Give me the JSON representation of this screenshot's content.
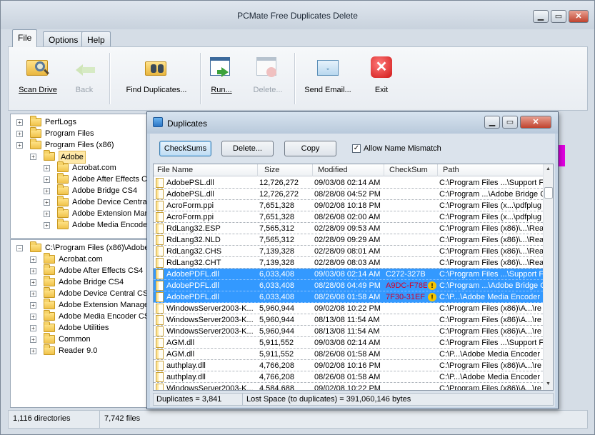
{
  "window": {
    "title": "PCMate Free Duplicates Delete",
    "minimize": "▁",
    "maximize": "▭",
    "close": "✕"
  },
  "tabs": [
    "File",
    "Options",
    "Help"
  ],
  "ribbon": {
    "scan_drive": "Scan Drive",
    "back": "Back",
    "find_duplicates": "Find Duplicates...",
    "run": "Run...",
    "delete": "Delete...",
    "send_email": "Send Email...",
    "exit": "Exit"
  },
  "tree_top": [
    {
      "label": "PerfLogs",
      "level": 0
    },
    {
      "label": "Program Files",
      "level": 0
    },
    {
      "label": "Program Files (x86)",
      "level": 0
    },
    {
      "label": "Adobe",
      "level": 1
    },
    {
      "label": "Acrobat.com",
      "level": 2
    },
    {
      "label": "Adobe After Effects CS4",
      "level": 2
    },
    {
      "label": "Adobe Bridge CS4",
      "level": 2
    },
    {
      "label": "Adobe Device Central CS4",
      "level": 2
    },
    {
      "label": "Adobe Extension Manager",
      "level": 2
    },
    {
      "label": "Adobe Media Encoder CS4",
      "level": 2
    }
  ],
  "tree_bottom": [
    {
      "label": "C:\\Program Files (x86)\\Adobe",
      "level": 0
    },
    {
      "label": "Acrobat.com",
      "level": 1
    },
    {
      "label": "Adobe After Effects CS4",
      "level": 1
    },
    {
      "label": "Adobe Bridge CS4",
      "level": 1
    },
    {
      "label": "Adobe Device Central CS4",
      "level": 1
    },
    {
      "label": "Adobe Extension Manager",
      "level": 1
    },
    {
      "label": "Adobe Media Encoder CS4",
      "level": 1
    },
    {
      "label": "Adobe Utilities",
      "level": 1
    },
    {
      "label": "Common",
      "level": 1
    },
    {
      "label": "Reader 9.0",
      "level": 1
    }
  ],
  "status": {
    "directories": "1,116 directories",
    "files": "7,742 files"
  },
  "dialog": {
    "title": "Duplicates",
    "checksums_btn": "CheckSums",
    "delete_btn": "Delete...",
    "copy_btn": "Copy",
    "allow_mismatch": "Allow Name Mismatch",
    "allow_mismatch_checked": "✓",
    "columns": [
      "File Name",
      "Size",
      "Modified",
      "CheckSum",
      "Path"
    ],
    "rows": [
      {
        "name": "AdobePSL.dll",
        "size": "12,726,272",
        "mod": "09/03/08 02:14 AM",
        "sum": "",
        "path": "C:\\Program Files ...\\Support F",
        "sel": false,
        "warn": false
      },
      {
        "name": "AdobePSL.dll",
        "size": "12,726,272",
        "mod": "08/28/08 04:52 PM",
        "sum": "",
        "path": "C:\\Program ...\\Adobe Bridge C",
        "sel": false,
        "warn": false
      },
      {
        "name": "AcroForm.ppi",
        "size": "7,651,328",
        "mod": "09/02/08 10:18 PM",
        "sum": "",
        "path": "C:\\Program Files (x...\\pdfplug",
        "sel": false,
        "warn": false
      },
      {
        "name": "AcroForm.ppi",
        "size": "7,651,328",
        "mod": "08/26/08 02:00 AM",
        "sum": "",
        "path": "C:\\Program Files (x...\\pdfplug",
        "sel": false,
        "warn": false
      },
      {
        "name": "RdLang32.ESP",
        "size": "7,565,312",
        "mod": "02/28/09 09:53 AM",
        "sum": "",
        "path": "C:\\Program Files (x86)\\...\\Rea",
        "sel": false,
        "warn": false
      },
      {
        "name": "RdLang32.NLD",
        "size": "7,565,312",
        "mod": "02/28/09 09:29 AM",
        "sum": "",
        "path": "C:\\Program Files (x86)\\...\\Rea",
        "sel": false,
        "warn": false
      },
      {
        "name": "RdLang32.CHS",
        "size": "7,139,328",
        "mod": "02/28/09 08:01 AM",
        "sum": "",
        "path": "C:\\Program Files (x86)\\...\\Rea",
        "sel": false,
        "warn": false
      },
      {
        "name": "RdLang32.CHT",
        "size": "7,139,328",
        "mod": "02/28/09 08:03 AM",
        "sum": "",
        "path": "C:\\Program Files (x86)\\...\\Rea",
        "sel": false,
        "warn": false
      },
      {
        "name": "AdobePDFL.dll",
        "size": "6,033,408",
        "mod": "09/03/08 02:14 AM",
        "sum": "C272-327B",
        "path": "C:\\Program Files ...\\Support F",
        "sel": true,
        "warn": false,
        "sumcolor": "#ffffff"
      },
      {
        "name": "AdobePDFL.dll",
        "size": "6,033,408",
        "mod": "08/28/08 04:49 PM",
        "sum": "A9DC-F78E",
        "path": "C:\\Program ...\\Adobe Bridge C",
        "sel": true,
        "warn": true,
        "sumcolor": "#d4002a"
      },
      {
        "name": "AdobePDFL.dll",
        "size": "6,033,408",
        "mod": "08/26/08 01:58 AM",
        "sum": "7F30-31EF",
        "path": "C:\\P...\\Adobe Media Encoder",
        "sel": true,
        "warn": true,
        "sumcolor": "#d4002a"
      },
      {
        "name": "WindowsServer2003-K...",
        "size": "5,960,944",
        "mod": "09/02/08 10:22 PM",
        "sum": "",
        "path": "C:\\Program Files (x86)\\A...\\re",
        "sel": false,
        "warn": false
      },
      {
        "name": "WindowsServer2003-K...",
        "size": "5,960,944",
        "mod": "08/13/08 11:54 AM",
        "sum": "",
        "path": "C:\\Program Files (x86)\\A...\\re",
        "sel": false,
        "warn": false
      },
      {
        "name": "WindowsServer2003-K...",
        "size": "5,960,944",
        "mod": "08/13/08 11:54 AM",
        "sum": "",
        "path": "C:\\Program Files (x86)\\A...\\re",
        "sel": false,
        "warn": false
      },
      {
        "name": "AGM.dll",
        "size": "5,911,552",
        "mod": "09/03/08 02:14 AM",
        "sum": "",
        "path": "C:\\Program Files ...\\Support F",
        "sel": false,
        "warn": false
      },
      {
        "name": "AGM.dll",
        "size": "5,911,552",
        "mod": "08/26/08 01:58 AM",
        "sum": "",
        "path": "C:\\P...\\Adobe Media Encoder",
        "sel": false,
        "warn": false
      },
      {
        "name": "authplay.dll",
        "size": "4,766,208",
        "mod": "09/02/08 10:16 PM",
        "sum": "",
        "path": "C:\\Program Files (x86)\\A...\\re",
        "sel": false,
        "warn": false
      },
      {
        "name": "authplay.dll",
        "size": "4,766,208",
        "mod": "08/26/08 01:58 AM",
        "sum": "",
        "path": "C:\\P...\\Adobe Media Encoder",
        "sel": false,
        "warn": false
      },
      {
        "name": "WindowsServer2003-K...",
        "size": "4,584,688",
        "mod": "09/02/08 10:22 PM",
        "sum": "",
        "path": "C:\\Program Files (x86)\\A...\\re",
        "sel": false,
        "warn": false
      }
    ],
    "status_left": "Duplicates = 3,841",
    "status_right": "Lost Space (to duplicates) = 391,060,146 bytes"
  }
}
